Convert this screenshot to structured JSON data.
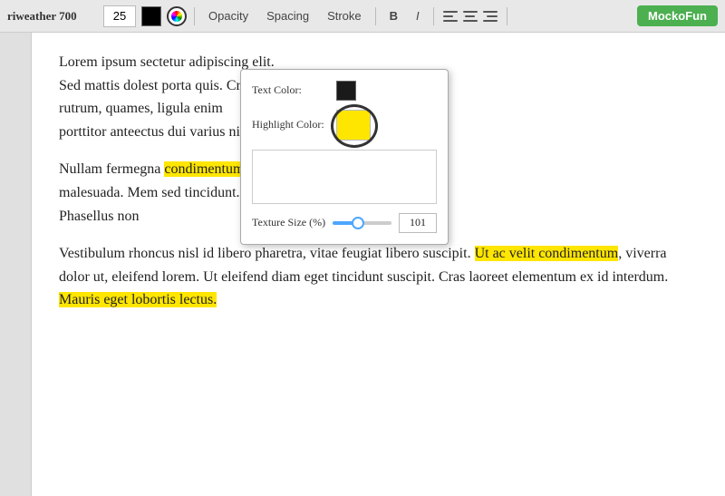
{
  "toolbar": {
    "font_name": "riweather 700",
    "font_size": "25",
    "opacity_label": "Opacity",
    "spacing_label": "Spacing",
    "stroke_label": "Stroke",
    "bold_label": "B",
    "italic_label": "I",
    "mocko_label": "MockoFun"
  },
  "color_popup": {
    "text_color_label": "Text Color:",
    "highlight_color_label": "Highlight Color:",
    "texture_size_label": "Texture Size (%)",
    "texture_size_value": "101"
  },
  "content": {
    "paragraph1": "Lorem ipsum ",
    "paragraph1_mid": "sectetur adipiscing elit. Sed mattis dol",
    "paragraph1_mid2": "est porta quis. Cras rutrum, quam",
    "paragraph1_mid3": "es, ligula enim porttitor ante",
    "paragraph1_end": "ectus dui varius nibh.",
    "paragraph2_start": "Nullam ferme",
    "paragraph2_highlight1": "condimentum",
    "paragraph2_mid": "gna ",
    "paragraph2_mid2": "malesuada. M",
    "paragraph2_mid3": "em sed tincidunt.",
    "paragraph2_end": "Phasellus non",
    "paragraph3": "Vestibulum rhoncus nisl id libero pharetra, vitae feugiat libero suscipit. ",
    "paragraph3_highlight": "Ut ac velit condimentum",
    "paragraph3_mid": ", viverra dolor ut, eleifend lorem. Ut eleifend diam eget tincidunt suscipit. Cras laoreet elementum ex id interdum. ",
    "paragraph3_highlight2": "Mauris eget lobortis lectus.",
    "paragraph3_end": ""
  }
}
